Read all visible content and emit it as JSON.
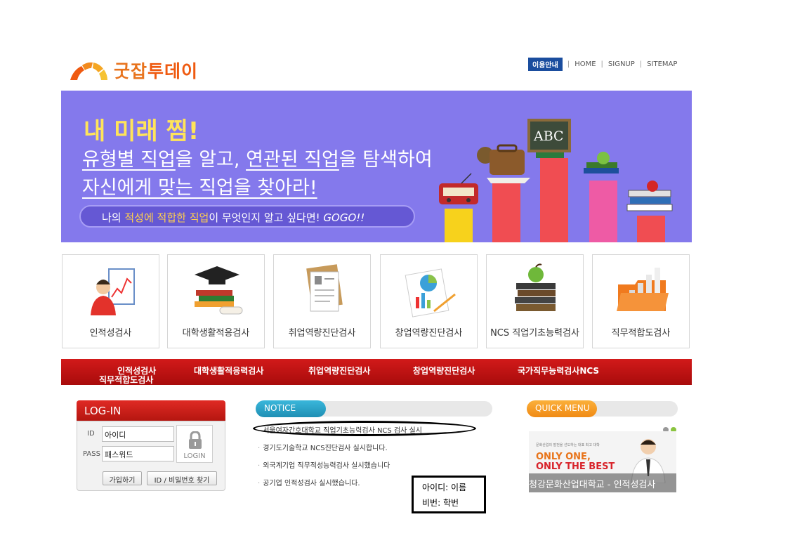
{
  "header": {
    "logo_text_a": "굿잡",
    "logo_text_b": "투데이",
    "nav": {
      "guide": "이용안내",
      "home": "HOME",
      "signup": "SIGNUP",
      "sitemap": "SITEMAP",
      "separator": "|"
    }
  },
  "banner": {
    "title": "내 미래 찜!",
    "line1_u1": "유형별 직업",
    "line1_t1": "을 알고, ",
    "line1_u2": "연관된 직업",
    "line1_t2": "을 탐색하여",
    "line2": "자신에게 맞는 직업을 찾아라!",
    "pill_pre": "나의 ",
    "pill_hl": "적성에 적합한 직업",
    "pill_post": "이 무엇인지 알고 싶다면! ",
    "pill_go": "GOGO!!",
    "board_text": "ABC"
  },
  "tests": [
    {
      "label": "인적성검사",
      "icon": "person-chart-icon"
    },
    {
      "label": "대학생활적응검사",
      "icon": "graduation-books-icon"
    },
    {
      "label": "취업역량진단검사",
      "icon": "resume-icon"
    },
    {
      "label": "창업역량진단검사",
      "icon": "pie-chart-icon"
    },
    {
      "label": "NCS 직업기초능력검사",
      "icon": "apple-books-icon"
    },
    {
      "label": "직무적합도검사",
      "icon": "bar-chart-folder-icon"
    }
  ],
  "redbar": {
    "item1": "인적성검사",
    "item1b": "직무적합도검사",
    "item2": "대학생활적응력검사",
    "item3": "취업역량진단검사",
    "item4": "창업역량진단검사",
    "item5": "국가직무능력검사NCS"
  },
  "login": {
    "title": "LOG-IN",
    "id_label": "ID",
    "id_value": "아이디",
    "pass_label": "PASS",
    "pass_value": "패스워드",
    "login_button": "LOGIN",
    "join_button": "가입하기",
    "find_button": "ID / 비밀번호 찾기"
  },
  "notice": {
    "title": "NOTICE",
    "items": [
      "서울여자간호대학교 직업기초능력검사 NCS 검사 실시",
      "경기도기술학교 NCS진단검사 실시합니다.",
      "외국계기업 직무적성능력검사 실시했습니다",
      "공기업 인적성검사 실시했습니다."
    ],
    "bullet": "·"
  },
  "annotation": {
    "line1": "아이디: 이름",
    "line2": "비번: 학번"
  },
  "quick_menu": {
    "title": "QUICK MENU",
    "small_text": "문화산업의 발전을 선도하는 대표 최고 대학",
    "slogan1": "ONLY ONE,",
    "slogan2": "ONLY THE BEST",
    "caption": "청강문화산업대학교 - 인적성검사"
  },
  "colors": {
    "brand_orange": "#ef5a10",
    "banner_purple": "#8479ec",
    "red_bar": "#c41414",
    "notice_teal": "#2aa3c9",
    "quick_orange": "#f5961f",
    "guide_blue": "#1a4d9e"
  }
}
